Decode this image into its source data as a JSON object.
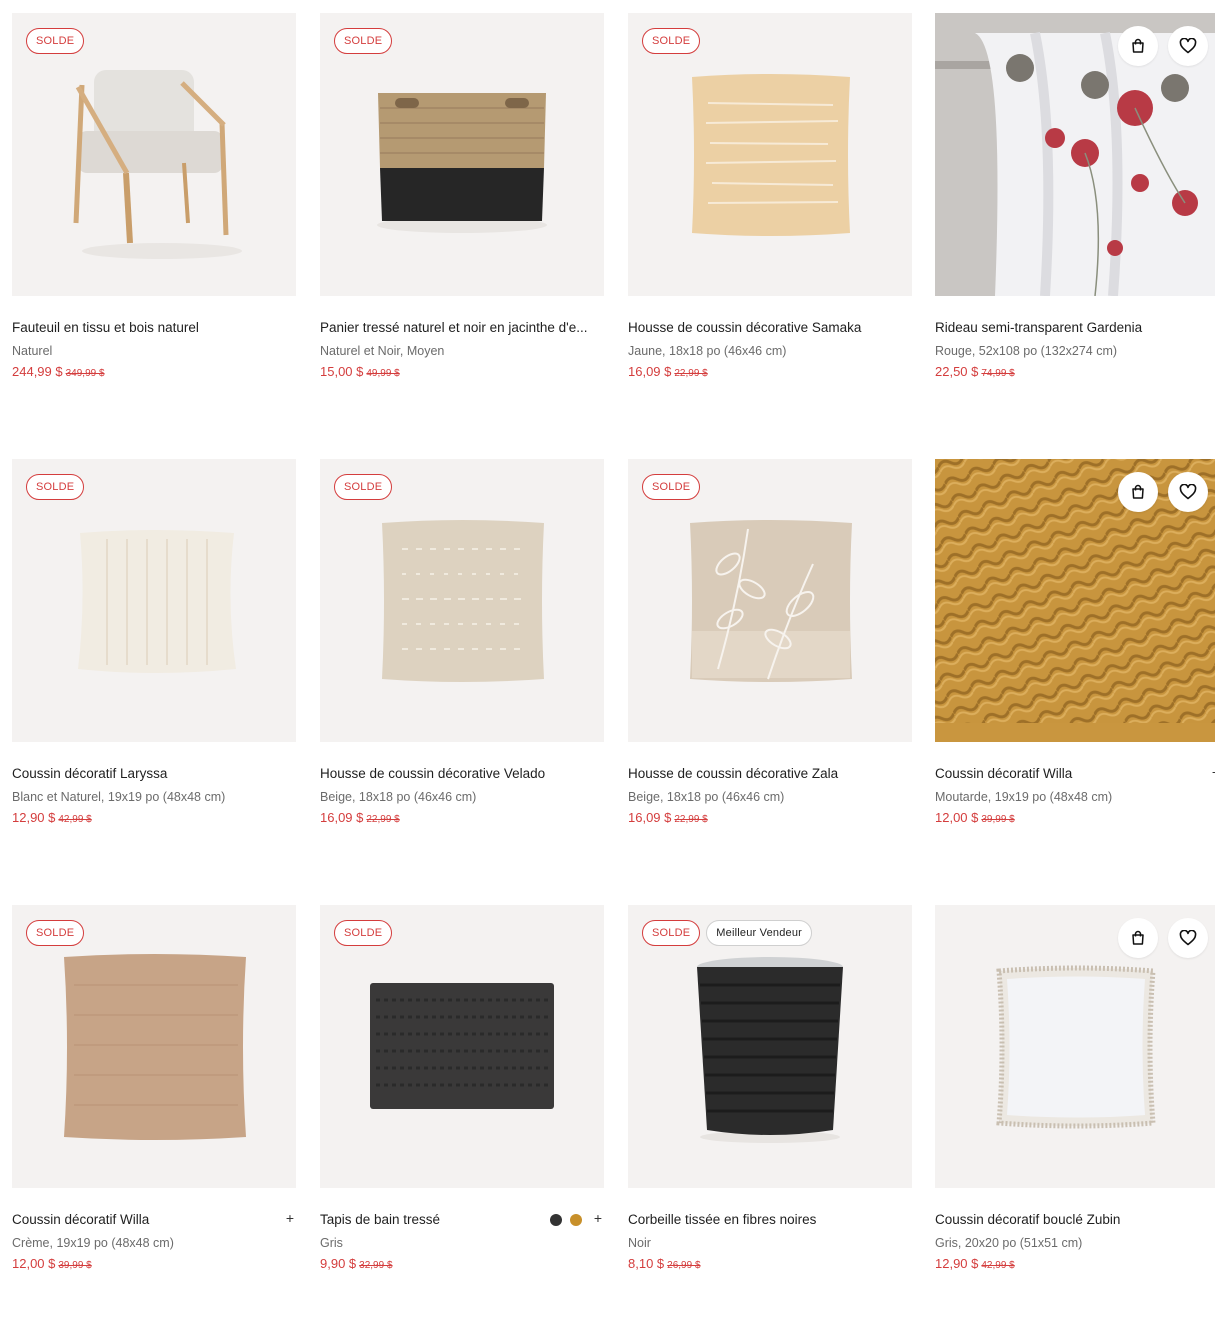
{
  "badges": {
    "sale": "SOLDE",
    "best_seller": "Meilleur Vendeur"
  },
  "icons": {
    "bag": "shopping-bag-icon",
    "heart": "heart-icon",
    "plus": "plus-icon"
  },
  "colors": {
    "sale_red": "#d43d3d",
    "image_bg": "#f4f2f1"
  },
  "products": [
    {
      "name": "Fauteuil en tissu et bois naturel",
      "variant": "Naturel",
      "price": "244,99 $",
      "was": "349,99 $",
      "plus": ""
    },
    {
      "name": "Panier tressé naturel et noir en jacinthe d'e...",
      "variant": "Naturel et Noir, Moyen",
      "price": "15,00 $",
      "was": "49,99 $",
      "plus": ""
    },
    {
      "name": "Housse de coussin décorative Samaka",
      "variant": "Jaune, 18x18 po (46x46 cm)",
      "price": "16,09 $",
      "was": "22,99 $",
      "plus": ""
    },
    {
      "name": "Rideau semi-transparent Gardenia",
      "variant": "Rouge, 52x108 po (132x274 cm)",
      "price": "22,50 $",
      "was": "74,99 $",
      "plus": ""
    },
    {
      "name": "Coussin décoratif Laryssa",
      "variant": "Blanc et Naturel, 19x19 po (48x48 cm)",
      "price": "12,90 $",
      "was": "42,99 $",
      "plus": ""
    },
    {
      "name": "Housse de coussin décorative Velado",
      "variant": "Beige, 18x18 po (46x46 cm)",
      "price": "16,09 $",
      "was": "22,99 $",
      "plus": ""
    },
    {
      "name": "Housse de coussin décorative Zala",
      "variant": "Beige, 18x18 po (46x46 cm)",
      "price": "16,09 $",
      "was": "22,99 $",
      "plus": ""
    },
    {
      "name": "Coussin décoratif Willa",
      "variant": "Moutarde, 19x19 po (48x48 cm)",
      "price": "12,00 $",
      "was": "39,99 $",
      "plus": "+"
    },
    {
      "name": "Coussin décoratif Willa",
      "variant": "Crème, 19x19 po (48x48 cm)",
      "price": "12,00 $",
      "was": "39,99 $",
      "plus": "+"
    },
    {
      "name": "Tapis de bain tressé",
      "variant": "Gris",
      "price": "9,90 $",
      "was": "32,99 $",
      "plus": "+"
    },
    {
      "name": "Corbeille tissée en fibres noires",
      "variant": "Noir",
      "price": "8,10 $",
      "was": "26,99 $",
      "plus": ""
    },
    {
      "name": "Coussin décoratif bouclé Zubin",
      "variant": "Gris, 20x20 po (51x51 cm)",
      "price": "12,90 $",
      "was": "42,99 $",
      "plus": ""
    }
  ]
}
